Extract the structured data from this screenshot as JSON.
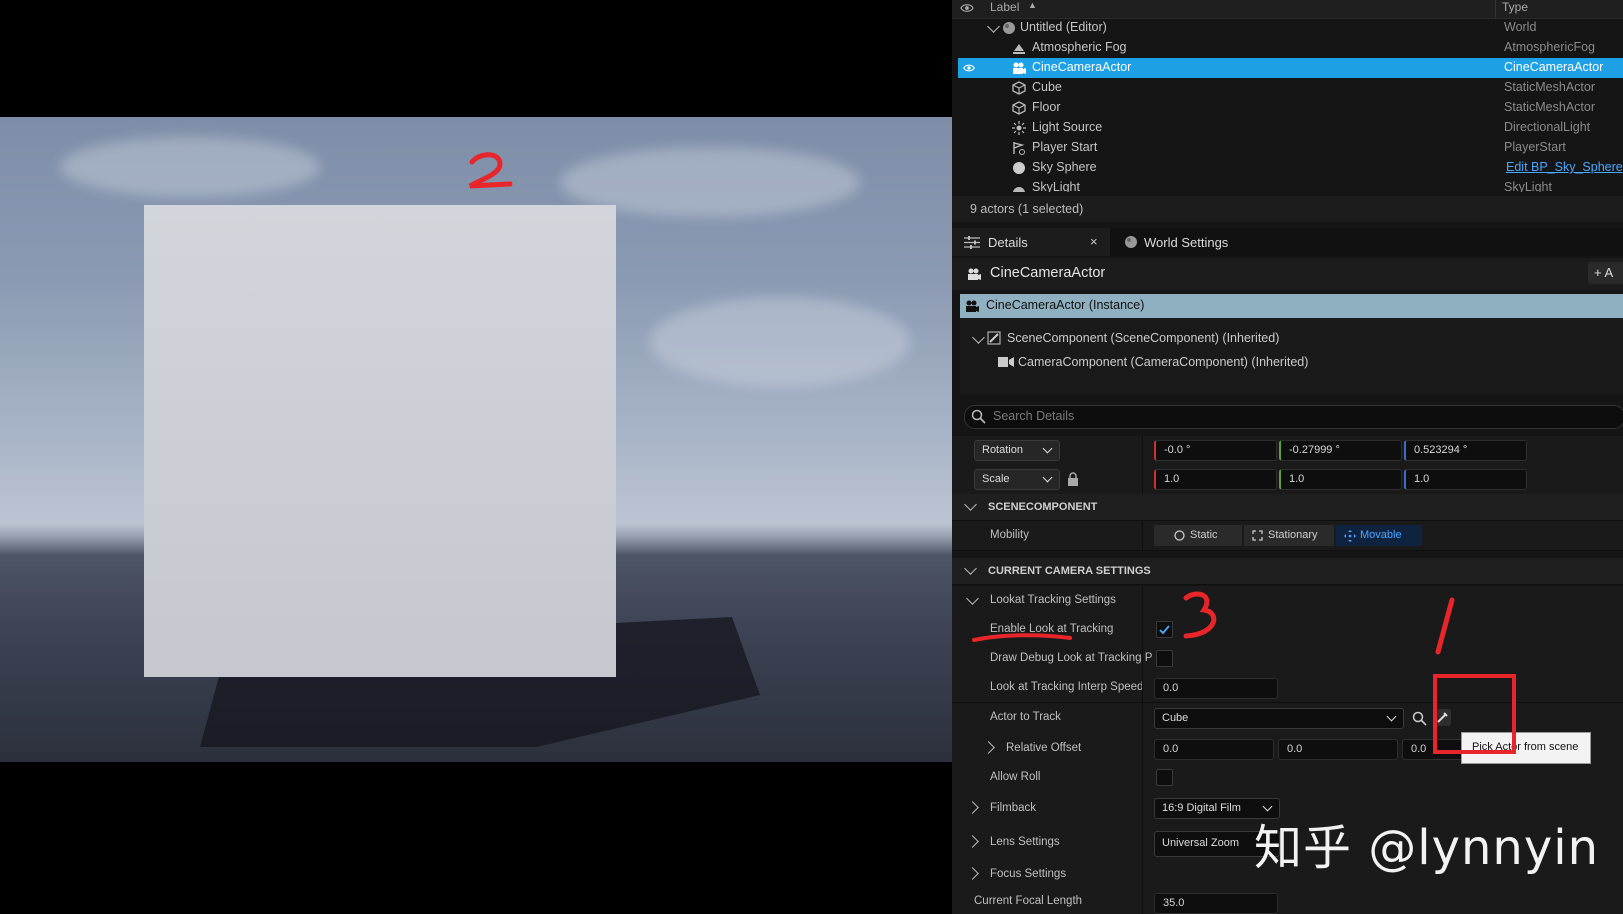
{
  "outliner": {
    "header": {
      "label": "Label",
      "type": "Type"
    },
    "rows": [
      {
        "label": "Untitled (Editor)",
        "type": "World",
        "icon": "world-icon"
      },
      {
        "label": "Atmospheric Fog",
        "type": "AtmosphericFog",
        "icon": "fog-icon"
      },
      {
        "label": "CineCameraActor",
        "type": "CineCameraActor",
        "icon": "camera-icon",
        "selected": true
      },
      {
        "label": "Cube",
        "type": "StaticMeshActor",
        "icon": "cube-icon"
      },
      {
        "label": "Floor",
        "type": "StaticMeshActor",
        "icon": "cube-icon"
      },
      {
        "label": "Light Source",
        "type": "DirectionalLight",
        "icon": "light-icon"
      },
      {
        "label": "Player Start",
        "type": "PlayerStart",
        "icon": "player-start-icon"
      },
      {
        "label": "Sky Sphere",
        "type": "Edit BP_Sky_Sphere",
        "icon": "sphere-icon"
      },
      {
        "label": "SkyLight",
        "type": "SkyLight",
        "icon": "skylight-icon"
      }
    ],
    "count": "9 actors (1 selected)"
  },
  "tabs": {
    "details": "Details",
    "world_settings": "World Settings"
  },
  "details": {
    "title": "CineCameraActor",
    "add_button": "+ A",
    "instance": "CineCameraActor (Instance)",
    "components": [
      "SceneComponent (SceneComponent) (Inherited)",
      "CameraComponent (CameraComponent) (Inherited)"
    ],
    "search_placeholder": "Search Details",
    "rotation": {
      "label": "Rotation",
      "x": "-0.0 °",
      "y": "-0.27999 °",
      "z": "0.523294 °"
    },
    "scale": {
      "label": "Scale",
      "x": "1.0",
      "y": "1.0",
      "z": "1.0"
    },
    "scene_section": "SCENECOMPONENT",
    "mobility": {
      "label": "Mobility",
      "static": "Static",
      "stationary": "Stationary",
      "movable": "Movable"
    },
    "camera_section": "CURRENT CAMERA SETTINGS",
    "lookat": {
      "group": "Lookat Tracking Settings",
      "enable": "Enable Look at Tracking",
      "enable_checked": true,
      "draw_debug": "Draw Debug Look at Tracking P",
      "interp_label": "Look at Tracking Interp Speed",
      "interp_value": "0.0",
      "actor_label": "Actor to Track",
      "actor_value": "Cube",
      "offset_label": "Relative Offset",
      "offset_x": "0.0",
      "offset_y": "0.0",
      "offset_z": "0.0",
      "allow_roll": "Allow Roll"
    },
    "filmback": {
      "label": "Filmback",
      "value": "16:9 Digital Film"
    },
    "lens": {
      "label": "Lens Settings",
      "value": "Universal Zoom"
    },
    "focus": {
      "label": "Focus Settings"
    },
    "focal": {
      "label": "Current Focal Length",
      "value": "35.0"
    }
  },
  "tooltip": "Pick Actor from scene",
  "annotations": {
    "one": "1",
    "two": "2",
    "three": "3"
  },
  "watermark": "知乎 @lynnyin",
  "colors": {
    "selection": "#1ea0e6",
    "annotation_red": "#e8262a",
    "instance_bar": "#8fb0c0"
  }
}
